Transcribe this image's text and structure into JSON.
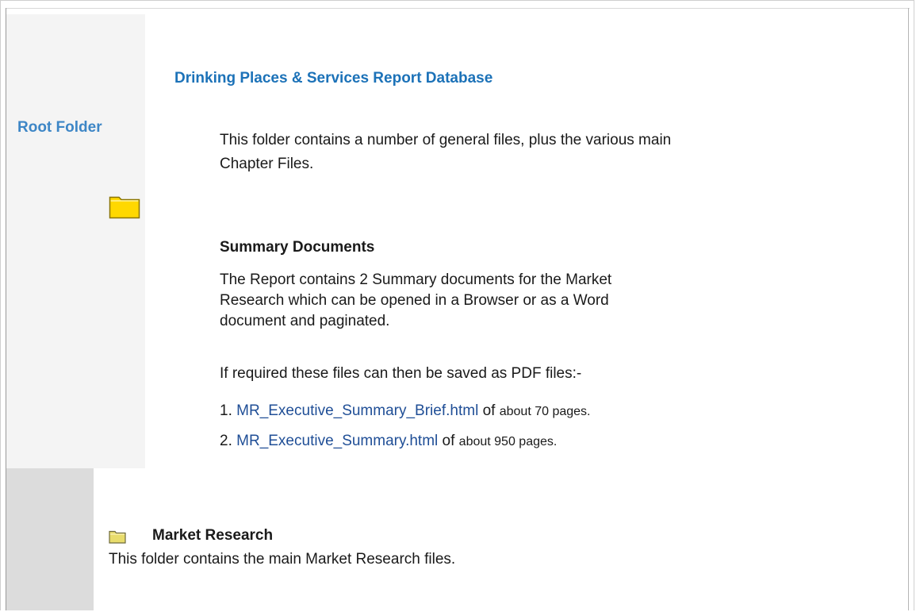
{
  "sidebar": {
    "root_folder_label": "Root Folder"
  },
  "main": {
    "title": "Drinking Places & Services Report Database",
    "intro": "This folder contains a number of general files, plus the various main Chapter Files.",
    "summary": {
      "heading": "Summary Documents",
      "description": "The Report contains 2 Summary documents for the Market Research which can be opened in a Browser or as a Word document and paginated.",
      "pdf_note": "If required these files can then be saved as PDF files:-",
      "documents": [
        {
          "number": "1.",
          "link": "MR_Executive_Summary_Brief.html",
          "of": "of",
          "pages": "about 70 pages."
        },
        {
          "number": "2.",
          "link": "MR_Executive_Summary.html",
          "of": "of",
          "pages": "about 950 pages."
        }
      ]
    }
  },
  "market_research": {
    "title": "Market Research",
    "description": "This folder contains the main Market Research files."
  },
  "icons": {
    "root_folder": "folder-icon",
    "market_research_folder": "folder-icon"
  },
  "colors": {
    "link_blue": "#1c72b8",
    "root_link": "#3d86c6",
    "doc_link": "#1f4e96",
    "folder_yellow": "#ffd800"
  }
}
